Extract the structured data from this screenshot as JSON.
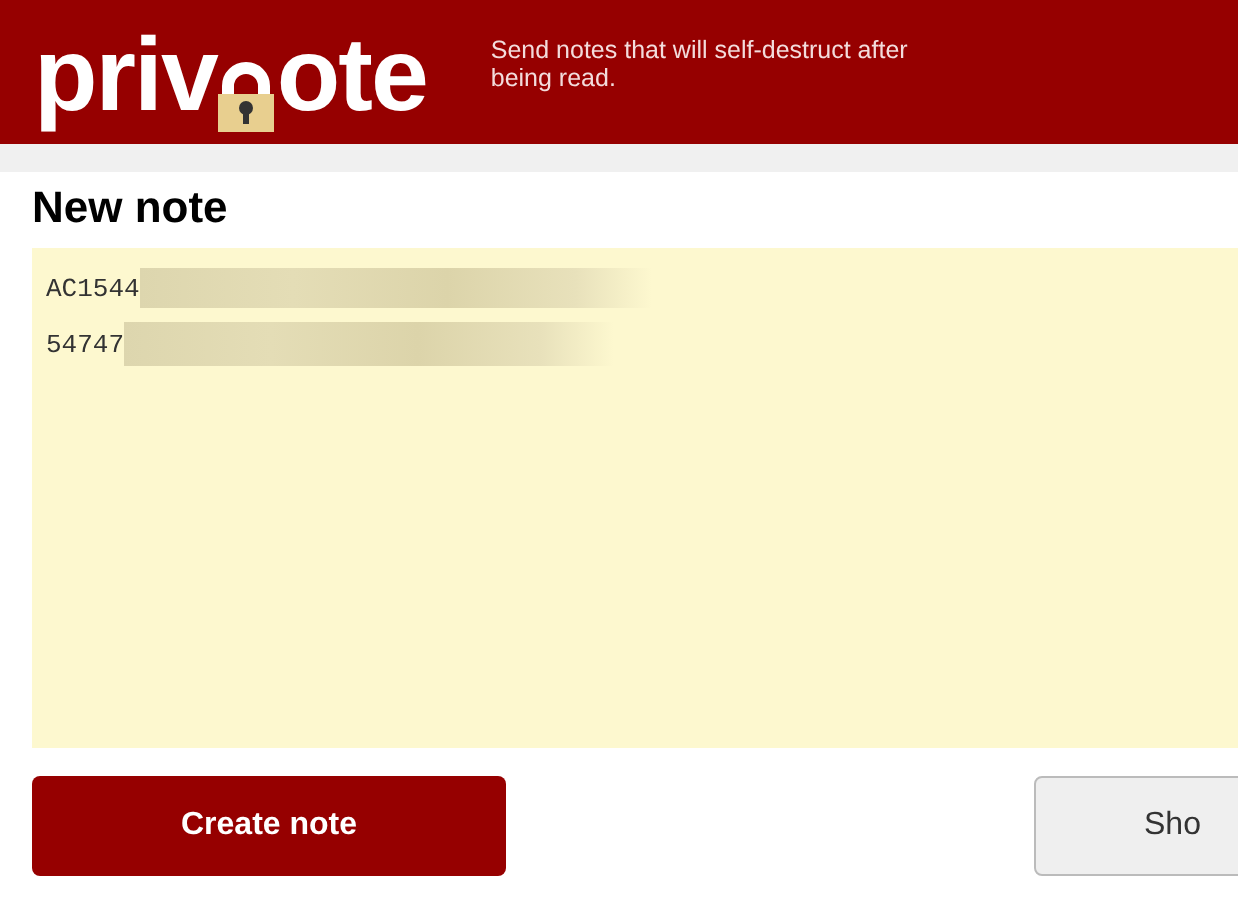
{
  "header": {
    "logo": {
      "before": "priv",
      "after": "ote"
    },
    "tagline": "Send notes that will self-destruct after being read."
  },
  "note": {
    "title": "New note",
    "lines": [
      {
        "text": "AC1544",
        "redacted": true
      },
      {
        "text": "54747",
        "redacted": true
      }
    ]
  },
  "buttons": [
    {
      "label": "Create note",
      "kind": "primary"
    },
    {
      "label": "Sho",
      "kind": "secondary"
    }
  ]
}
